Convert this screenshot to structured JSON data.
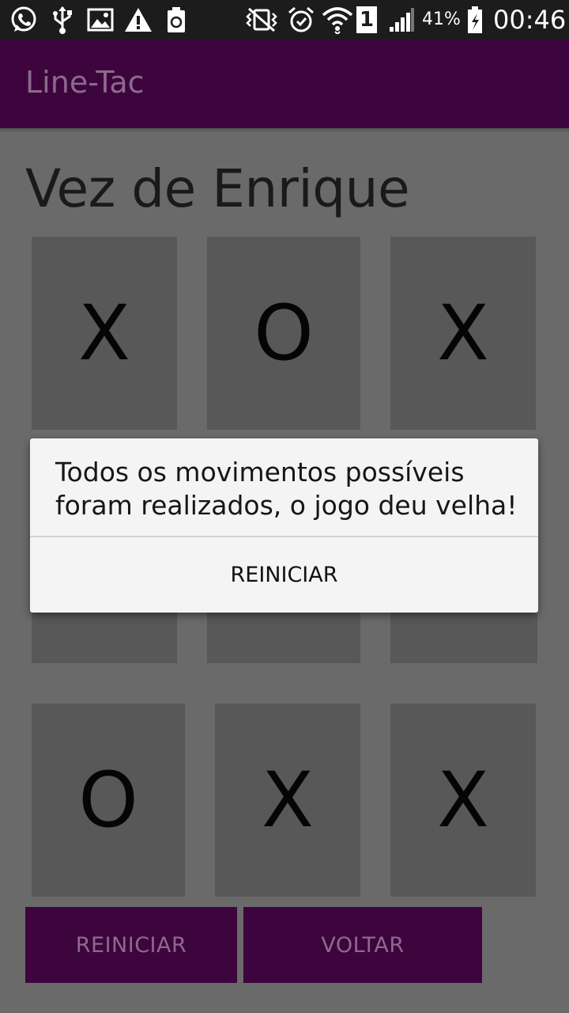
{
  "status_bar": {
    "icons": [
      "whatsapp-icon",
      "usb-icon",
      "image-icon",
      "warning-icon",
      "recycle-battery-icon",
      "vibrate-mute-icon",
      "alarm-icon",
      "wifi-icon",
      "sim-1-icon",
      "signal-icon",
      "battery-icon"
    ],
    "sim": "1",
    "battery": "41%",
    "time": "00:46"
  },
  "app_bar": {
    "title": "Line-Tac"
  },
  "game": {
    "turn_label": "Vez de Enrique",
    "board": [
      [
        "X",
        "O",
        "X"
      ],
      [
        "",
        "",
        ""
      ],
      [
        "O",
        "X",
        "X"
      ]
    ]
  },
  "buttons": {
    "restart": "REINICIAR",
    "back": "VOLTAR"
  },
  "dialog": {
    "message": "Todos os movimentos possíveis foram realizados, o jogo deu velha!",
    "button": "REINICIAR"
  },
  "colors": {
    "primary": "#3e043e",
    "background": "#6a6a6a",
    "cell": "#585858",
    "dialog": "#f4f4f4"
  }
}
